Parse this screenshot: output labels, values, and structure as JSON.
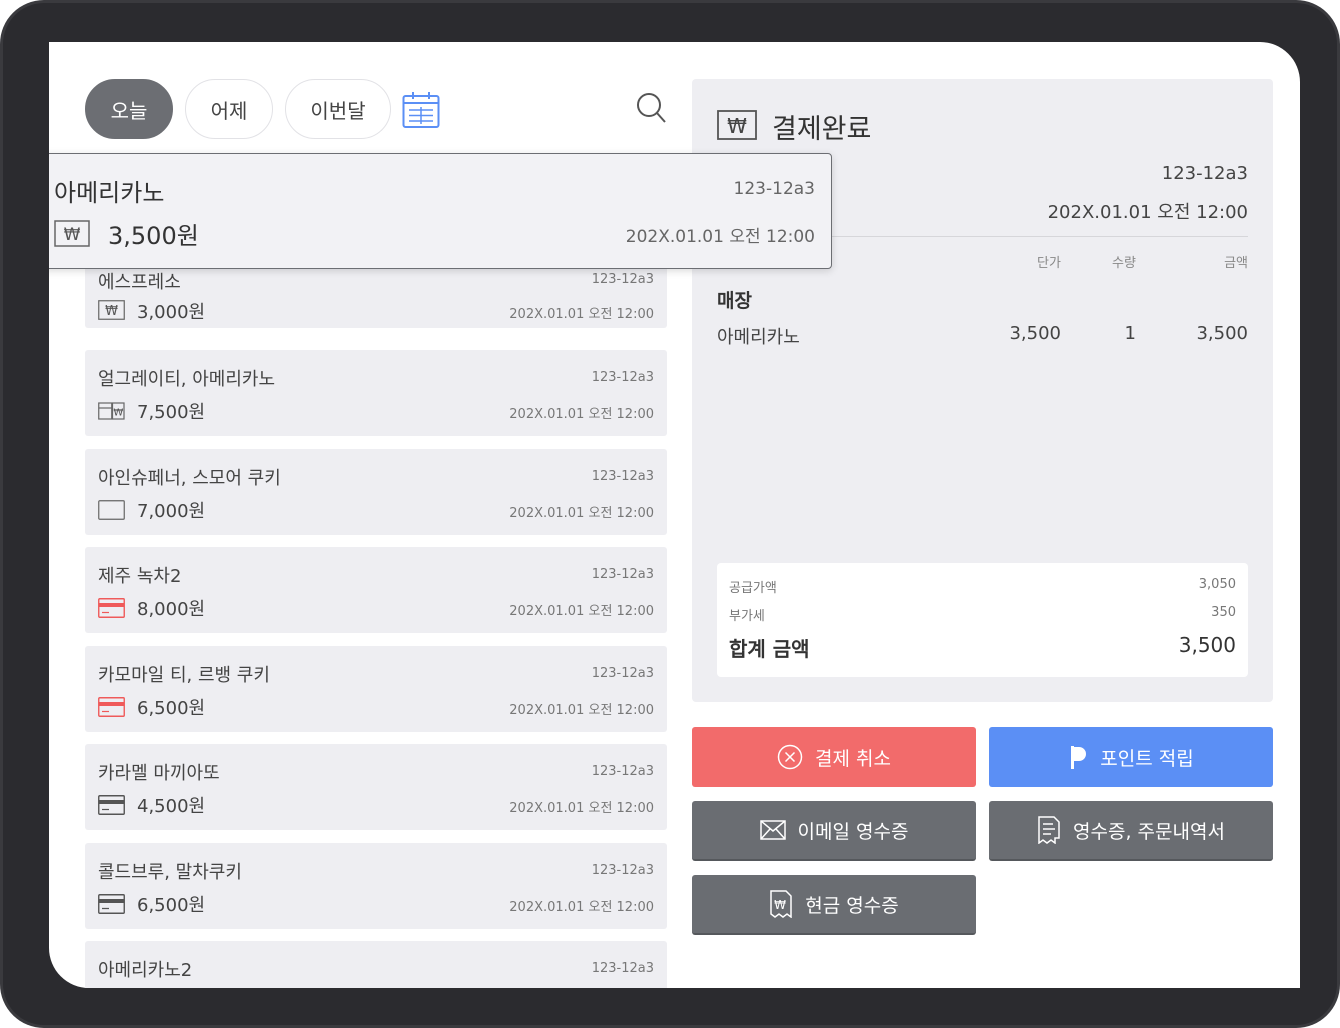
{
  "filters": {
    "today": "오늘",
    "yesterday": "어제",
    "this_month": "이번달"
  },
  "popup": {
    "name": "아메리카노",
    "order_id": "123-12a3",
    "amount": "3,500원",
    "date": "202X.01.01 오전 12:00",
    "payment_icon": "cash-won-icon"
  },
  "orders": [
    {
      "name": "에스프레소",
      "order_id": "123-12a3",
      "amount": "3,000원",
      "date": "202X.01.01 오전 12:00",
      "payment_icon": "cash-won-icon"
    },
    {
      "name": "얼그레이티, 아메리카노",
      "order_id": "123-12a3",
      "amount": "7,500원",
      "date": "202X.01.01 오전 12:00",
      "payment_icon": "split-card-cash-icon"
    },
    {
      "name": "아인슈페너, 스모어 쿠키",
      "order_id": "123-12a3",
      "amount": "7,000원",
      "date": "202X.01.01 오전 12:00",
      "payment_icon": "blank-card-icon"
    },
    {
      "name": "제주 녹차2",
      "order_id": "123-12a3",
      "amount": "8,000원",
      "date": "202X.01.01 오전 12:00",
      "payment_icon": "red-card-icon"
    },
    {
      "name": "카모마일 티, 르뱅 쿠키",
      "order_id": "123-12a3",
      "amount": "6,500원",
      "date": "202X.01.01 오전 12:00",
      "payment_icon": "red-card-icon"
    },
    {
      "name": "카라멜 마끼아또",
      "order_id": "123-12a3",
      "amount": "4,500원",
      "date": "202X.01.01 오전 12:00",
      "payment_icon": "credit-card-icon"
    },
    {
      "name": "콜드브루, 말차쿠키",
      "order_id": "123-12a3",
      "amount": "6,500원",
      "date": "202X.01.01 오전 12:00",
      "payment_icon": "credit-card-icon"
    },
    {
      "name": "아메리카노2",
      "order_id": "123-12a3",
      "amount": "",
      "date": "",
      "payment_icon": ""
    }
  ],
  "detail": {
    "title": "결제완료",
    "order_id": "123-12a3",
    "date": "202X.01.01 오전 12:00",
    "columns": {
      "unit_price": "단가",
      "quantity": "수량",
      "amount": "금액"
    },
    "store": "매장",
    "items": [
      {
        "name": "아메리카노",
        "unit_price": "3,500",
        "quantity": "1",
        "amount": "3,500"
      }
    ],
    "summary": {
      "supply_label": "공급가액",
      "supply_value": "3,050",
      "vat_label": "부가세",
      "vat_value": "350",
      "total_label": "합계 금액",
      "total_value": "3,500"
    }
  },
  "actions": {
    "cancel": "결제 취소",
    "points": "포인트 적립",
    "email_receipt": "이메일 영수증",
    "receipt_order": "영수증, 주문내역서",
    "cash_receipt": "현금 영수증"
  },
  "colors": {
    "cancel": "#f26b6b",
    "points": "#5b8ff5",
    "gray_button": "#6a6d72",
    "active_filter": "#6c6e73",
    "card_bg": "#eeeef2"
  }
}
